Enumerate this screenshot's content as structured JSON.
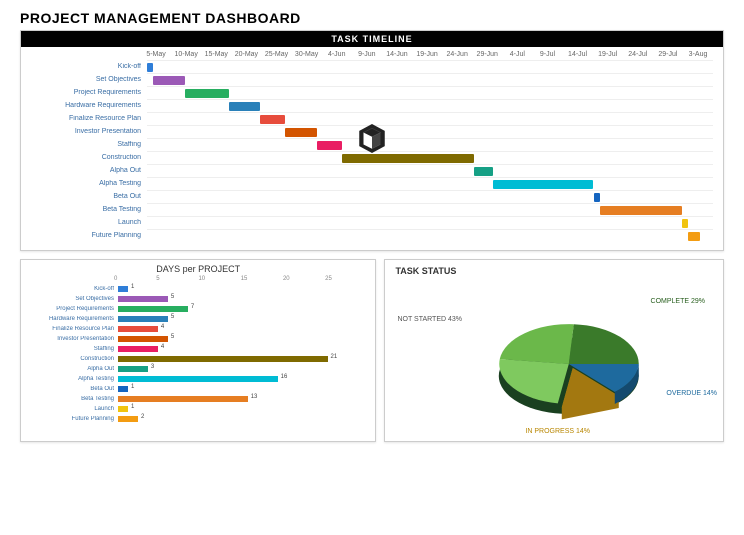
{
  "title": "PROJECT MANAGEMENT DASHBOARD",
  "timeline": {
    "header": "TASK TIMELINE",
    "dates": [
      "5-May",
      "10-May",
      "15-May",
      "20-May",
      "25-May",
      "30-May",
      "4-Jun",
      "9-Jun",
      "14-Jun",
      "19-Jun",
      "24-Jun",
      "29-Jun",
      "4-Jul",
      "9-Jul",
      "14-Jul",
      "19-Jul",
      "24-Jul",
      "29-Jul",
      "3-Aug"
    ],
    "tasks": [
      {
        "name": "Kick-off",
        "start": 0,
        "dur": 1,
        "color": "#2f7ed8"
      },
      {
        "name": "Set Objectives",
        "start": 1,
        "dur": 5,
        "color": "#9b59b6"
      },
      {
        "name": "Project Requirements",
        "start": 6,
        "dur": 7,
        "color": "#27ae60"
      },
      {
        "name": "Hardware Requirements",
        "start": 13,
        "dur": 5,
        "color": "#2980b9"
      },
      {
        "name": "Finalize Resource Plan",
        "start": 18,
        "dur": 4,
        "color": "#e74c3c"
      },
      {
        "name": "Investor Presentation",
        "start": 22,
        "dur": 5,
        "color": "#d35400"
      },
      {
        "name": "Staffing",
        "start": 27,
        "dur": 4,
        "color": "#e91e63"
      },
      {
        "name": "Construction",
        "start": 31,
        "dur": 21,
        "color": "#7f6a00"
      },
      {
        "name": "Alpha Out",
        "start": 52,
        "dur": 3,
        "color": "#16a085"
      },
      {
        "name": "Alpha Testing",
        "start": 55,
        "dur": 16,
        "color": "#00bcd4"
      },
      {
        "name": "Beta Out",
        "start": 71,
        "dur": 1,
        "color": "#1565c0"
      },
      {
        "name": "Beta Testing",
        "start": 72,
        "dur": 13,
        "color": "#e67e22"
      },
      {
        "name": "Launch",
        "start": 85,
        "dur": 1,
        "color": "#f1c40f"
      },
      {
        "name": "Future Planning",
        "start": 86,
        "dur": 2,
        "color": "#f39c12"
      }
    ],
    "total_days": 90
  },
  "days_chart": {
    "title": "DAYS per PROJECT",
    "ticks": [
      "0",
      "5",
      "10",
      "15",
      "20",
      "25"
    ],
    "max": 25,
    "rows": [
      {
        "name": "Kick-off",
        "val": 1,
        "color": "#2f7ed8"
      },
      {
        "name": "Set Objectives",
        "val": 5,
        "color": "#9b59b6"
      },
      {
        "name": "Project Requirements",
        "val": 7,
        "color": "#27ae60"
      },
      {
        "name": "Hardware Requirements",
        "val": 5,
        "color": "#2980b9"
      },
      {
        "name": "Finalize Resource Plan",
        "val": 4,
        "color": "#e74c3c"
      },
      {
        "name": "Investor Presentation",
        "val": 5,
        "color": "#d35400"
      },
      {
        "name": "Staffing",
        "val": 4,
        "color": "#e91e63"
      },
      {
        "name": "Construction",
        "val": 21,
        "color": "#7f6a00"
      },
      {
        "name": "Alpha Out",
        "val": 3,
        "color": "#16a085"
      },
      {
        "name": "Alpha Testing",
        "val": 16,
        "color": "#00bcd4"
      },
      {
        "name": "Beta Out",
        "val": 1,
        "color": "#1565c0"
      },
      {
        "name": "Beta Testing",
        "val": 13,
        "color": "#e67e22"
      },
      {
        "name": "Launch",
        "val": 1,
        "color": "#f1c40f"
      },
      {
        "name": "Future Planning",
        "val": 2,
        "color": "#f39c12"
      }
    ]
  },
  "status_chart": {
    "title": "TASK STATUS",
    "labels": {
      "complete": "COMPLETE\n29%",
      "not_started": "NOT STARTED\n43%",
      "overdue": "OVERDUE\n14%",
      "in_progress": "IN PROGRESS\n14%"
    }
  },
  "chart_data": [
    {
      "type": "bar",
      "title": "TASK TIMELINE",
      "orientation": "gantt",
      "x_start": "5-May",
      "x_end": "3-Aug",
      "x_ticks": [
        "5-May",
        "10-May",
        "15-May",
        "20-May",
        "25-May",
        "30-May",
        "4-Jun",
        "9-Jun",
        "14-Jun",
        "19-Jun",
        "24-Jun",
        "29-Jun",
        "4-Jul",
        "9-Jul",
        "14-Jul",
        "19-Jul",
        "24-Jul",
        "29-Jul",
        "3-Aug"
      ],
      "tasks": [
        {
          "name": "Kick-off",
          "start": "5-May",
          "duration_days": 1
        },
        {
          "name": "Set Objectives",
          "start": "6-May",
          "duration_days": 5
        },
        {
          "name": "Project Requirements",
          "start": "11-May",
          "duration_days": 7
        },
        {
          "name": "Hardware Requirements",
          "start": "18-May",
          "duration_days": 5
        },
        {
          "name": "Finalize Resource Plan",
          "start": "23-May",
          "duration_days": 4
        },
        {
          "name": "Investor Presentation",
          "start": "27-May",
          "duration_days": 5
        },
        {
          "name": "Staffing",
          "start": "1-Jun",
          "duration_days": 4
        },
        {
          "name": "Construction",
          "start": "5-Jun",
          "duration_days": 21
        },
        {
          "name": "Alpha Out",
          "start": "26-Jun",
          "duration_days": 3
        },
        {
          "name": "Alpha Testing",
          "start": "29-Jun",
          "duration_days": 16
        },
        {
          "name": "Beta Out",
          "start": "15-Jul",
          "duration_days": 1
        },
        {
          "name": "Beta Testing",
          "start": "16-Jul",
          "duration_days": 13
        },
        {
          "name": "Launch",
          "start": "29-Jul",
          "duration_days": 1
        },
        {
          "name": "Future Planning",
          "start": "30-Jul",
          "duration_days": 2
        }
      ]
    },
    {
      "type": "bar",
      "title": "DAYS per PROJECT",
      "orientation": "horizontal",
      "xlabel": "",
      "ylabel": "",
      "xlim": [
        0,
        25
      ],
      "categories": [
        "Kick-off",
        "Set Objectives",
        "Project Requirements",
        "Hardware Requirements",
        "Finalize Resource Plan",
        "Investor Presentation",
        "Staffing",
        "Construction",
        "Alpha Out",
        "Alpha Testing",
        "Beta Out",
        "Beta Testing",
        "Launch",
        "Future Planning"
      ],
      "values": [
        1,
        5,
        7,
        5,
        4,
        5,
        4,
        21,
        3,
        16,
        1,
        13,
        1,
        2
      ]
    },
    {
      "type": "pie",
      "title": "TASK STATUS",
      "categories": [
        "NOT STARTED",
        "COMPLETE",
        "OVERDUE",
        "IN PROGRESS"
      ],
      "values": [
        43,
        29,
        14,
        14
      ],
      "colors": [
        "#6bb84a",
        "#3a7a2a",
        "#1e6a9e",
        "#d4a015"
      ]
    }
  ]
}
